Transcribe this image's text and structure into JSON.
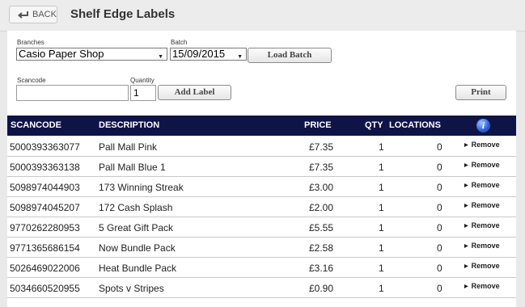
{
  "header": {
    "back_label": "BACK",
    "title": "Shelf Edge Labels"
  },
  "form": {
    "branches_label": "Branches",
    "branch_value": "Casio Paper Shop",
    "batch_label": "Batch",
    "batch_value": "15/09/2015",
    "load_batch_label": "Load Batch",
    "scancode_label": "Scancode",
    "scancode_value": "",
    "quantity_label": "Quantity",
    "quantity_value": "1",
    "add_label_label": "Add Label",
    "print_label": "Print"
  },
  "table": {
    "columns": [
      "SCANCODE",
      "DESCRIPTION",
      "PRICE",
      "QTY",
      "LOCATIONS"
    ],
    "info_icon": "info-icon",
    "remove_label": "Remove",
    "rows": [
      {
        "scancode": "5000393363077",
        "description": "Pall Mall Pink",
        "price": "£7.35",
        "qty": "1",
        "locations": "0"
      },
      {
        "scancode": "5000393363138",
        "description": "Pall Mall Blue 1",
        "price": "£7.35",
        "qty": "1",
        "locations": "0"
      },
      {
        "scancode": "5098974044903",
        "description": "173 Winning Streak",
        "price": "£3.00",
        "qty": "1",
        "locations": "0"
      },
      {
        "scancode": "5098974045207",
        "description": "172 Cash Splash",
        "price": "£2.00",
        "qty": "1",
        "locations": "0"
      },
      {
        "scancode": "9770262280953",
        "description": "5 Great Gift Pack",
        "price": "£5.55",
        "qty": "1",
        "locations": "0"
      },
      {
        "scancode": "9771365686154",
        "description": "Now Bundle Pack",
        "price": "£2.58",
        "qty": "1",
        "locations": "0"
      },
      {
        "scancode": "5026469022006",
        "description": "Heat Bundle Pack",
        "price": "£3.16",
        "qty": "1",
        "locations": "0"
      },
      {
        "scancode": "5034660520955",
        "description": "Spots v Stripes",
        "price": "£0.90",
        "qty": "1",
        "locations": "0"
      }
    ]
  },
  "colors": {
    "header_bg": "#0f1446",
    "info_icon": "#2c5fd6"
  }
}
